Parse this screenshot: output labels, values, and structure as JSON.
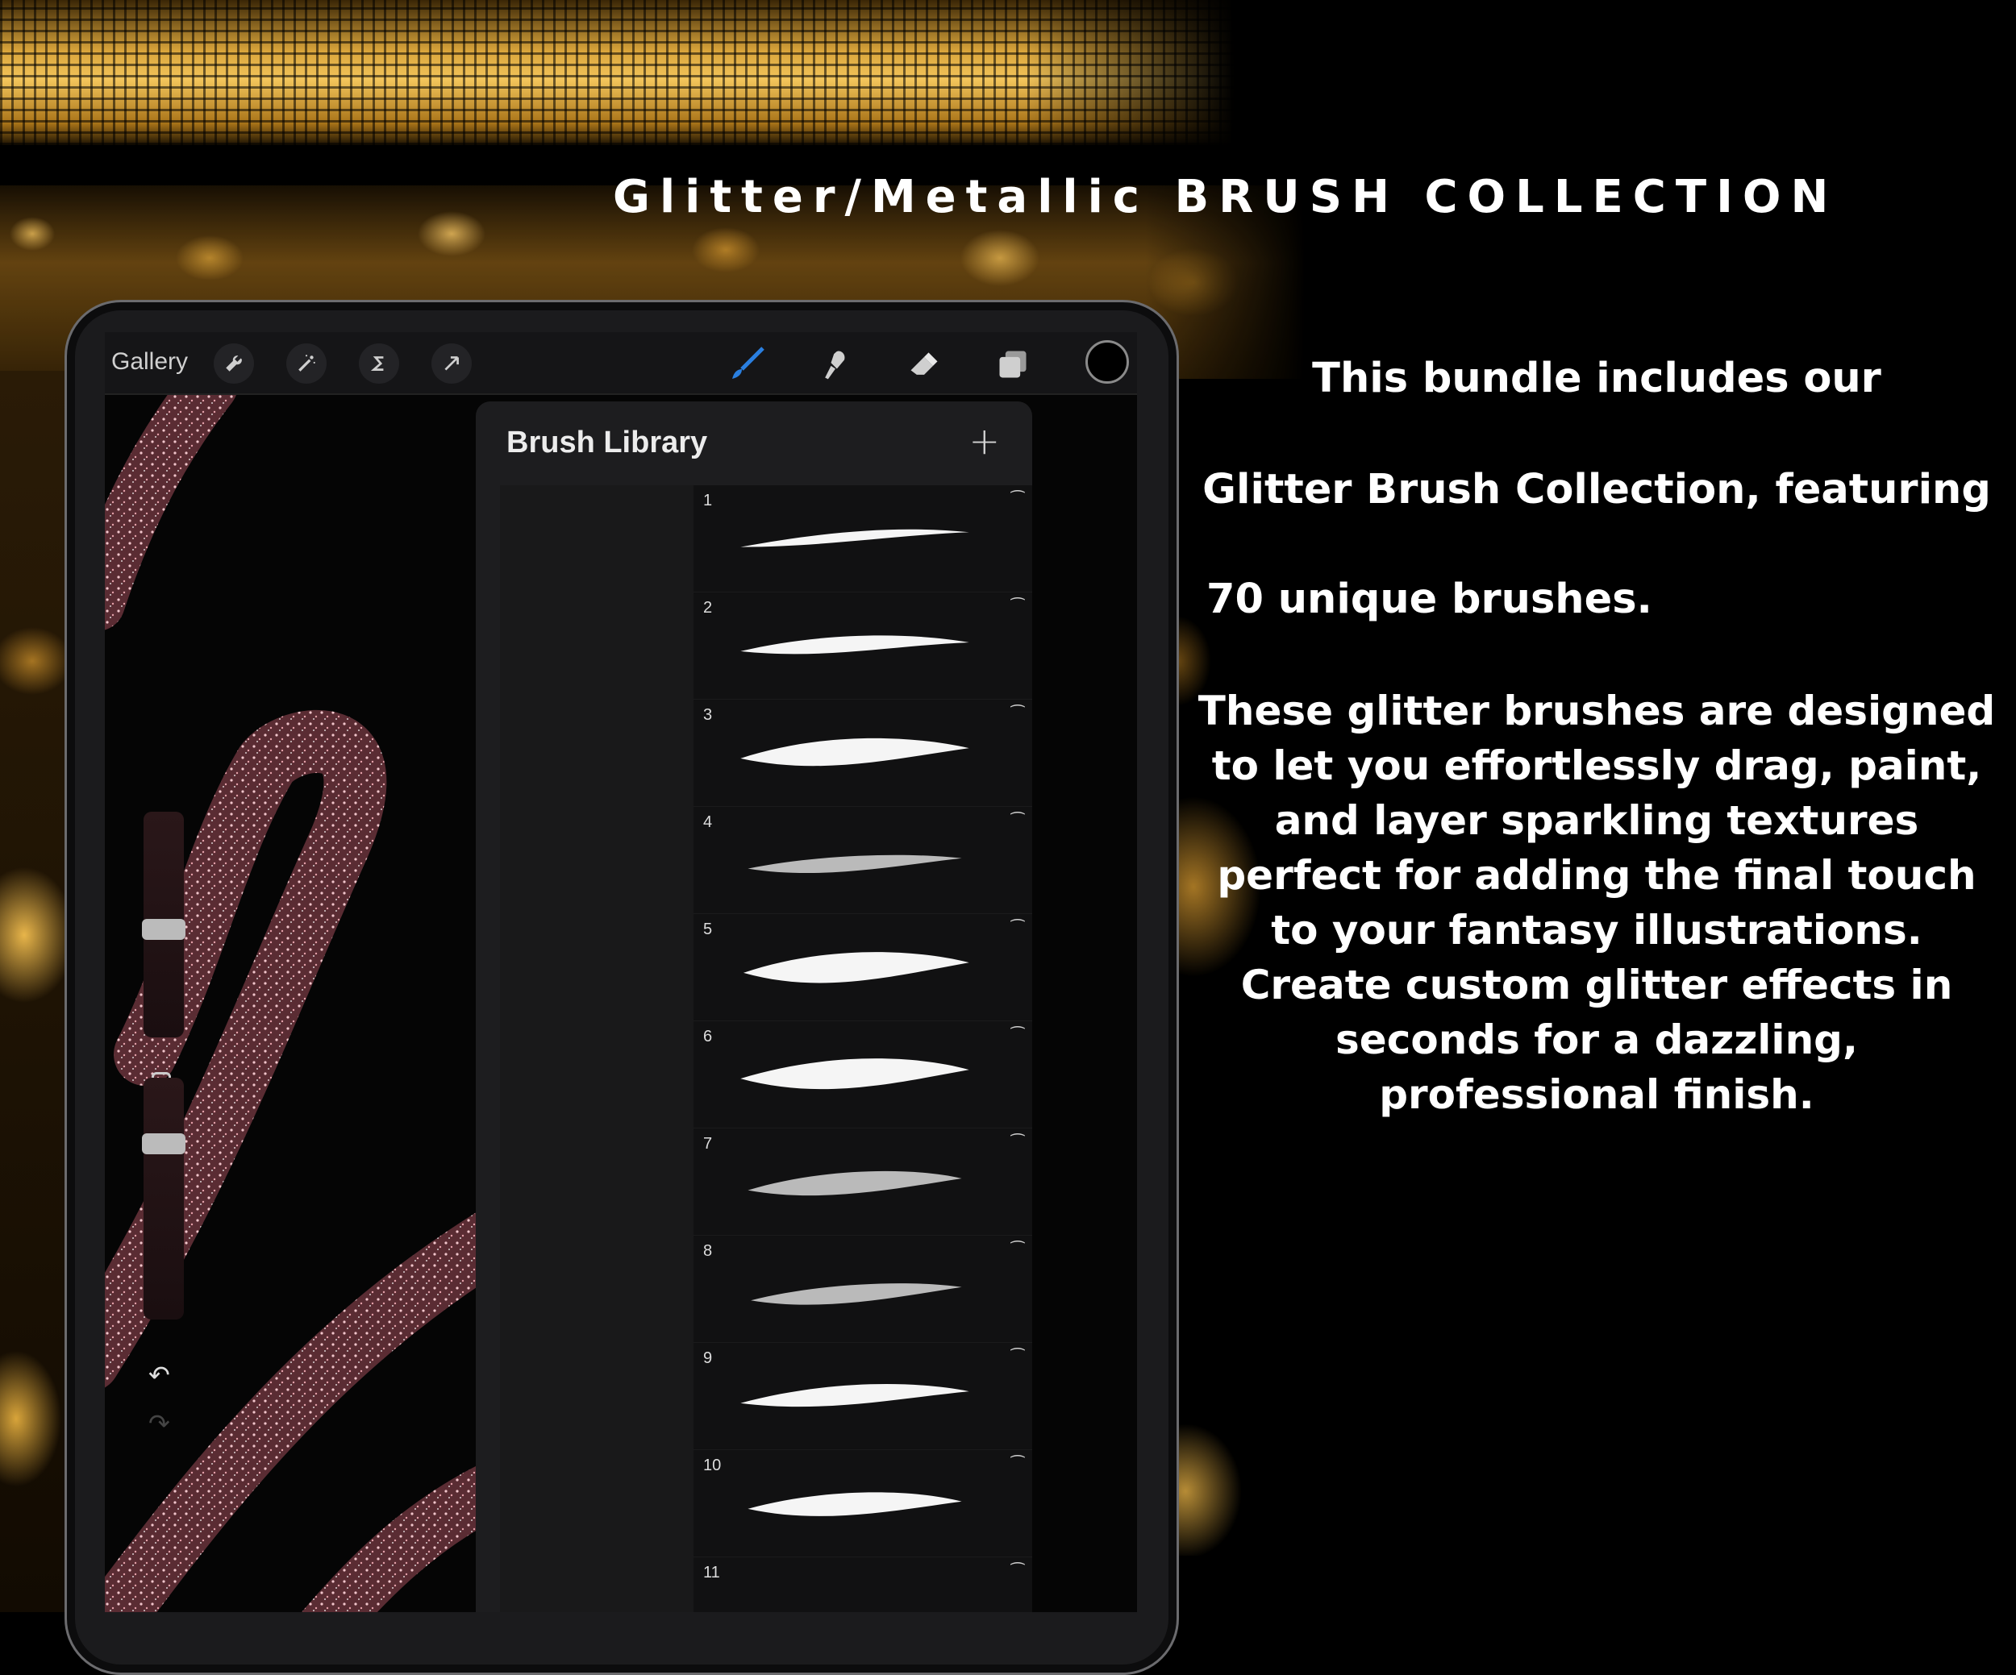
{
  "headline": "Glitter/Metallic BRUSH COLLECTION",
  "description": {
    "line1": "This bundle includes our",
    "line2": "Glitter Brush Collection, featuring",
    "line3": "70 unique brushes.",
    "paragraph": "These glitter brushes are designed to let you effortlessly drag, paint, and layer sparkling textures perfect for adding the final touch to your fantasy illustrations. Create custom glitter effects in seconds for a dazzling, professional finish."
  },
  "app": {
    "toolbar": {
      "gallery_label": "Gallery",
      "left_tools": [
        "wrench-icon",
        "magic-wand-icon",
        "selection-s-icon",
        "arrow-transform-icon"
      ],
      "right_tools": [
        "brush-icon",
        "smudge-icon",
        "eraser-icon",
        "layers-icon",
        "color-icon"
      ],
      "accent": "#2a7fe0"
    },
    "brush_library": {
      "title": "Brush Library",
      "add_symbol": "+",
      "brushes": [
        {
          "number": "1"
        },
        {
          "number": "2"
        },
        {
          "number": "3"
        },
        {
          "number": "4"
        },
        {
          "number": "5"
        },
        {
          "number": "6"
        },
        {
          "number": "7"
        },
        {
          "number": "8"
        },
        {
          "number": "9"
        },
        {
          "number": "10"
        },
        {
          "number": "11"
        }
      ]
    },
    "sidebar": {
      "undo_symbol": "↶",
      "redo_symbol": "↷"
    }
  },
  "colors": {
    "gold": "#d9a43a",
    "glitter_pink": "#c98a90",
    "text": "#ffffff"
  }
}
